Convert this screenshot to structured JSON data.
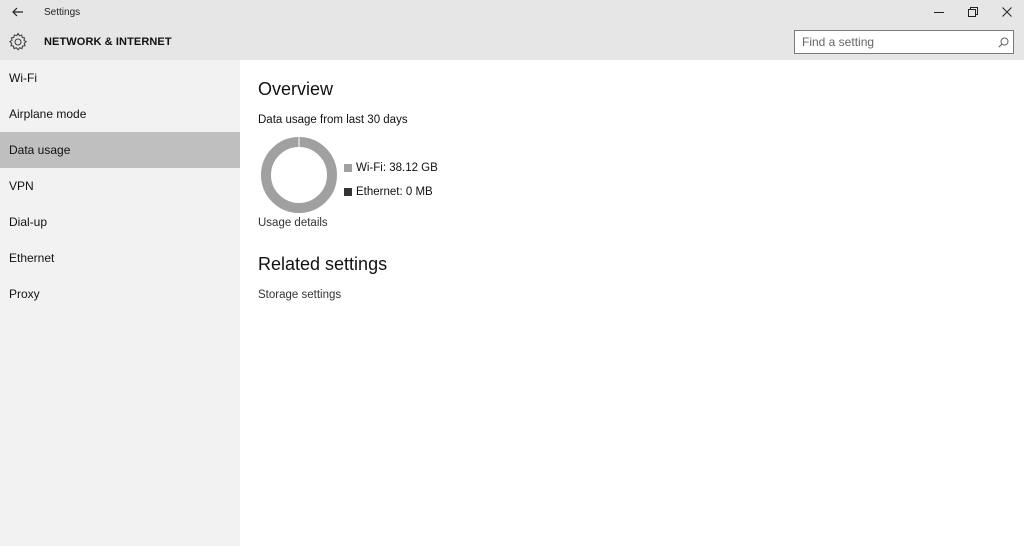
{
  "window": {
    "title": "Settings",
    "back_icon": "back-arrow-icon",
    "controls": [
      "minimize-icon",
      "restore-icon",
      "close-icon"
    ]
  },
  "header": {
    "section_title": "NETWORK & INTERNET",
    "icon": "gear-icon",
    "search": {
      "placeholder": "Find a setting",
      "value": ""
    }
  },
  "sidebar": {
    "items": [
      {
        "label": "Wi-Fi"
      },
      {
        "label": "Airplane mode"
      },
      {
        "label": "Data usage",
        "selected": true
      },
      {
        "label": "VPN"
      },
      {
        "label": "Dial-up"
      },
      {
        "label": "Ethernet"
      },
      {
        "label": "Proxy"
      }
    ]
  },
  "main": {
    "overview_title": "Overview",
    "usage_subtitle": "Data usage from last 30 days",
    "legend": [
      {
        "label": "Wi-Fi: 38.12 GB",
        "color": "#a0a0a0"
      },
      {
        "label": "Ethernet: 0 MB",
        "color": "#333333"
      }
    ],
    "usage_details_link": "Usage details",
    "related_title": "Related settings",
    "storage_link": "Storage settings"
  },
  "colors": {
    "chrome_bg": "#e6e6e6",
    "sidebar_bg": "#f2f2f2",
    "selected_bg": "#bfbfbf",
    "donut_wifi": "#a0a0a0",
    "donut_ethernet": "#333333"
  }
}
